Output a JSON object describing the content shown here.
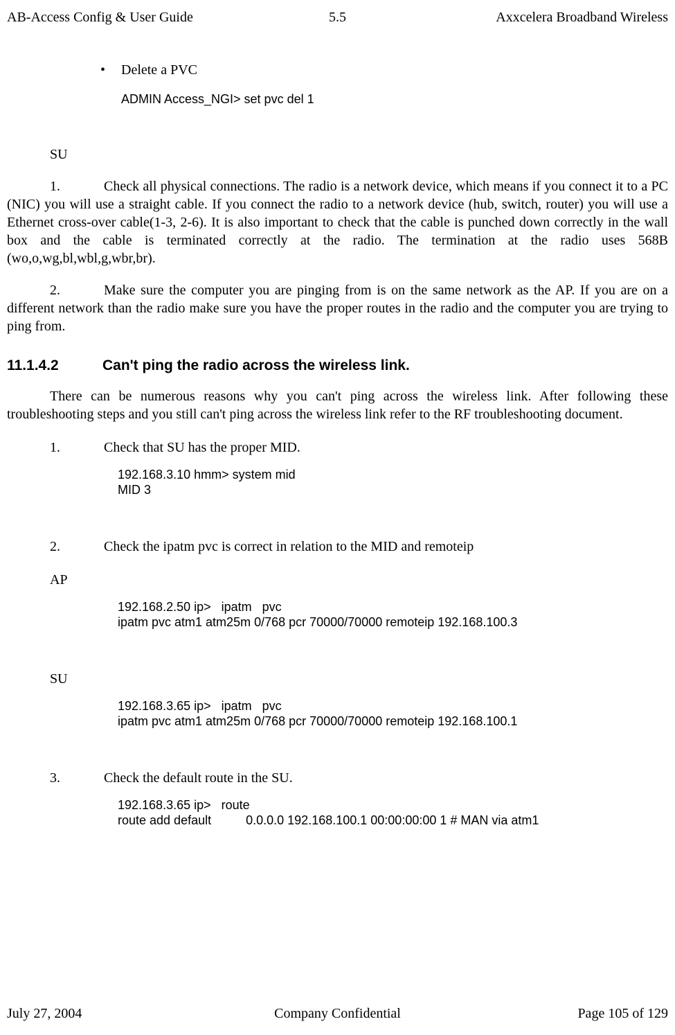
{
  "header": {
    "left": "AB-Access Config & User Guide",
    "center": "5.5",
    "right": "Axxcelera Broadband Wireless"
  },
  "bullet1": {
    "label": "Delete a PVC",
    "code": "ADMIN Access_NGI>   set   pvc   del   1"
  },
  "su_label": "SU",
  "para1": "Check all physical connections. The radio is a network device, which means if you connect it to a PC (NIC) you will use a straight cable. If you connect the radio to a network device (hub, switch, router) you will use a Ethernet cross-over cable(1-3, 2-6). It is also important to check that the cable is punched down correctly in the wall box and the cable is terminated correctly at the radio. The termination at the radio uses 568B (wo,o,wg,bl,wbl,g,wbr,br).",
  "para2": "Make sure the computer you are pinging from is on the same network as the AP. If you are on a different network than the radio make sure you have the proper routes in the radio and the computer you are trying to ping from.",
  "heading": {
    "num": "11.1.4.2",
    "text": "Can't ping the radio across the wireless link."
  },
  "para3": "There can be numerous reasons why you can't ping across the wireless link. After following these troubleshooting steps and you still can't ping across the wireless link refer to the RF troubleshooting document.",
  "step1": {
    "text": "Check that SU has the proper MID.",
    "code": "192.168.3.10 hmm> system mid\nMID 3"
  },
  "step2": {
    "text": "Check the ipatm pvc is correct in relation to the MID and remoteip"
  },
  "ap_label": "AP",
  "ap_code": "192.168.2.50 ip>   ipatm   pvc\nipatm pvc atm1 atm25m 0/768 pcr 70000/70000 remoteip 192.168.100.3",
  "su_label2": "SU",
  "su_code": "192.168.3.65 ip>   ipatm   pvc\nipatm pvc atm1 atm25m 0/768 pcr 70000/70000 remoteip 192.168.100.1",
  "step3": {
    "text": "Check the default route in the SU.",
    "code": "192.168.3.65 ip>   route\nroute add default          0.0.0.0 192.168.100.1 00:00:00:00 1 # MAN via atm1"
  },
  "footer": {
    "left": "July 27, 2004",
    "center": "Company Confidential",
    "right": "Page 105 of 129"
  },
  "nums": {
    "n1": "1.",
    "n2": "2.",
    "n3": "3."
  },
  "bullet_char": "•"
}
